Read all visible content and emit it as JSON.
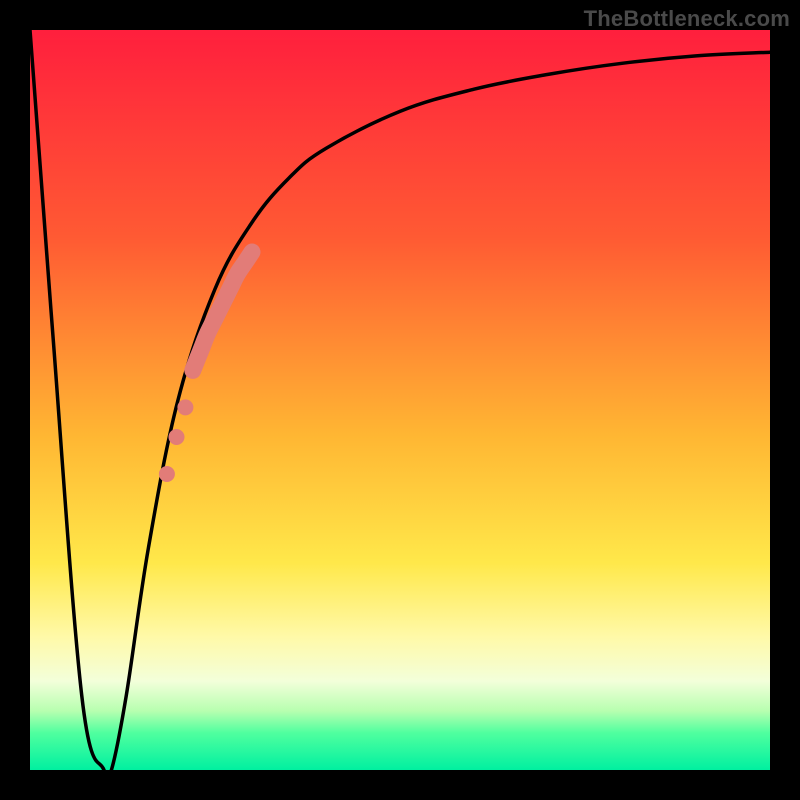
{
  "watermark": "TheBottleneck.com",
  "chart_data": {
    "type": "line",
    "title": "",
    "xlabel": "",
    "ylabel": "",
    "ylim": [
      0,
      100
    ],
    "xlim": [
      0,
      100
    ],
    "grid": false,
    "series": [
      {
        "name": "curve",
        "style": "line",
        "color": "#000000",
        "x": [
          0,
          3,
          7,
          10,
          11,
          13,
          16,
          20,
          25,
          30,
          35,
          40,
          50,
          60,
          70,
          80,
          90,
          100
        ],
        "y": [
          100,
          60,
          10,
          0,
          0,
          10,
          30,
          50,
          65,
          74,
          80,
          84,
          89,
          92,
          94,
          95.5,
          96.5,
          97
        ]
      },
      {
        "name": "dots-thick-segment",
        "style": "thick-dot-path",
        "color": "#e27c78",
        "x": [
          22,
          23,
          24,
          25,
          26,
          27,
          28,
          29,
          30
        ],
        "y": [
          54,
          56.5,
          59,
          61,
          63,
          65,
          67,
          68.5,
          70
        ]
      },
      {
        "name": "dots-isolated",
        "style": "dots",
        "color": "#e27c78",
        "x": [
          18.5,
          19.8,
          21
        ],
        "y": [
          40,
          45,
          49
        ]
      }
    ]
  }
}
